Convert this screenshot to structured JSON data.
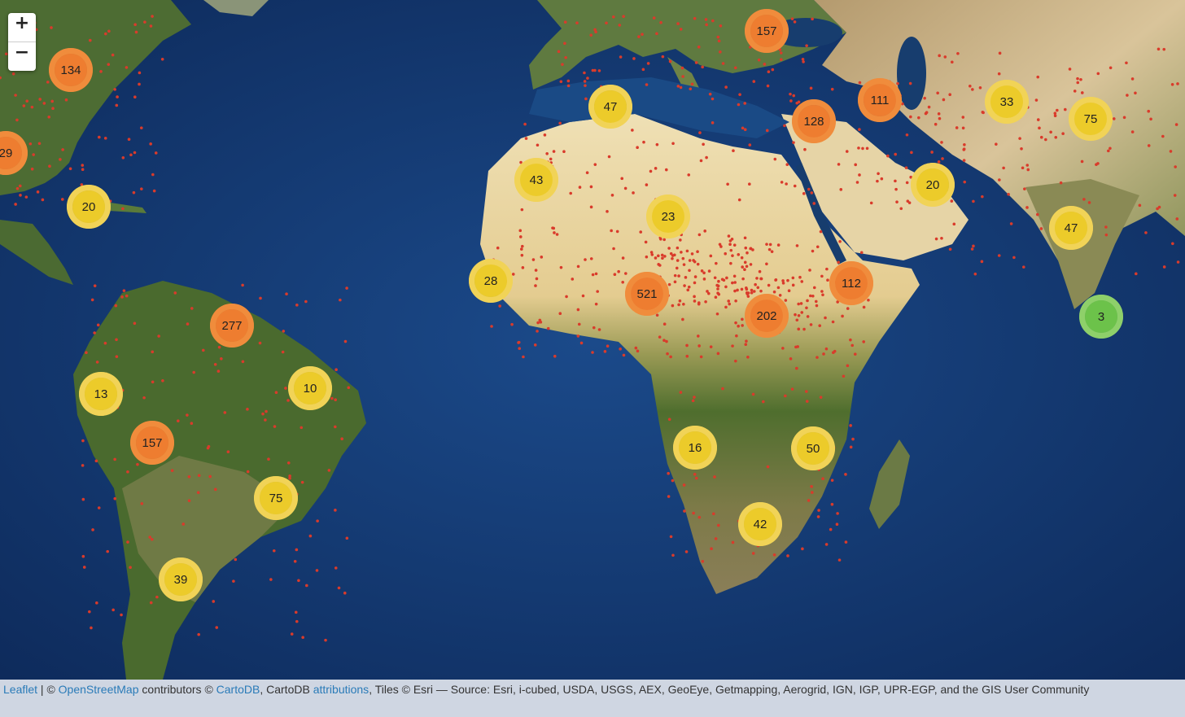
{
  "zoom": {
    "in_label": "+",
    "out_label": "−"
  },
  "clusters": [
    {
      "count": "134",
      "level": "orange"
    },
    {
      "count": "29",
      "level": "orange"
    },
    {
      "count": "20",
      "level": "yellow"
    },
    {
      "count": "157",
      "level": "orange"
    },
    {
      "count": "47",
      "level": "yellow"
    },
    {
      "count": "43",
      "level": "yellow"
    },
    {
      "count": "23",
      "level": "yellow"
    },
    {
      "count": "128",
      "level": "orange"
    },
    {
      "count": "111",
      "level": "orange"
    },
    {
      "count": "33",
      "level": "yellow"
    },
    {
      "count": "75",
      "level": "yellow"
    },
    {
      "count": "20",
      "level": "yellow"
    },
    {
      "count": "47",
      "level": "yellow"
    },
    {
      "count": "28",
      "level": "yellow"
    },
    {
      "count": "521",
      "level": "orange"
    },
    {
      "count": "112",
      "level": "orange"
    },
    {
      "count": "202",
      "level": "orange"
    },
    {
      "count": "3",
      "level": "green"
    },
    {
      "count": "277",
      "level": "orange"
    },
    {
      "count": "13",
      "level": "yellow"
    },
    {
      "count": "10",
      "level": "yellow"
    },
    {
      "count": "157",
      "level": "orange"
    },
    {
      "count": "75",
      "level": "yellow"
    },
    {
      "count": "39",
      "level": "yellow"
    },
    {
      "count": "16",
      "level": "yellow"
    },
    {
      "count": "50",
      "level": "yellow"
    },
    {
      "count": "42",
      "level": "yellow"
    }
  ],
  "colors": {
    "orange_outer": "#f08c3c",
    "orange_inner": "#ee7d30",
    "yellow_outer": "#f1d357",
    "yellow_inner": "#eccb2a",
    "green_outer": "#8ed06a",
    "green_inner": "#6cc24a",
    "ocean": "#12346a",
    "land": "#5a7a3a",
    "desert": "#e8d3a2",
    "marker": "#d93b2b"
  },
  "attribution": {
    "leaflet": "Leaflet",
    "sep1": " | © ",
    "osm": "OpenStreetMap",
    "t1": " contributors © ",
    "carto": "CartoDB",
    "t2": ", CartoDB ",
    "attributions": "attributions",
    "t3": ", Tiles © Esri — Source: Esri, i-cubed, USDA, USGS, AEX, GeoEye, Getmapping, Aerogrid, IGN, IGP, UPR-EGP, and the GIS User Community"
  }
}
